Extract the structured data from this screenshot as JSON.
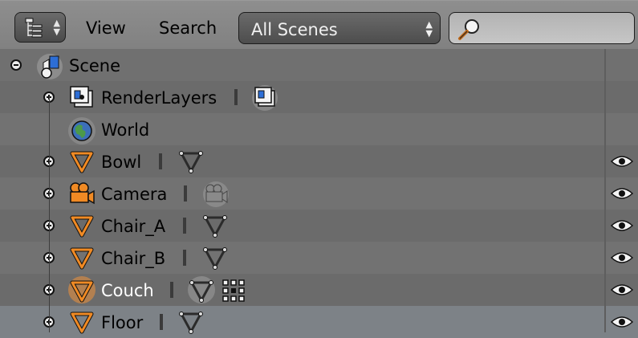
{
  "header": {
    "menu": [
      "View",
      "Search"
    ],
    "scene_select": "All Scenes",
    "search_value": ""
  },
  "tree": {
    "scene": "Scene",
    "rows": [
      {
        "name": "RenderLayers",
        "icon": "render-layers-icon"
      },
      {
        "name": "World",
        "icon": "world-icon"
      },
      {
        "name": "Bowl",
        "icon": "mesh-object-icon",
        "visible": true
      },
      {
        "name": "Camera",
        "icon": "camera-object-icon",
        "visible": true
      },
      {
        "name": "Chair_A",
        "icon": "mesh-object-icon",
        "visible": true
      },
      {
        "name": "Chair_B",
        "icon": "mesh-object-icon",
        "visible": true
      },
      {
        "name": "Couch",
        "icon": "mesh-object-icon",
        "visible": true,
        "active": true
      },
      {
        "name": "Floor",
        "icon": "mesh-object-icon",
        "visible": true,
        "selected_row": true
      }
    ]
  },
  "colors": {
    "active_object_text": "#ffffff",
    "selected_row_bg": "#7d8287",
    "mesh_icon": "#f08a24"
  }
}
